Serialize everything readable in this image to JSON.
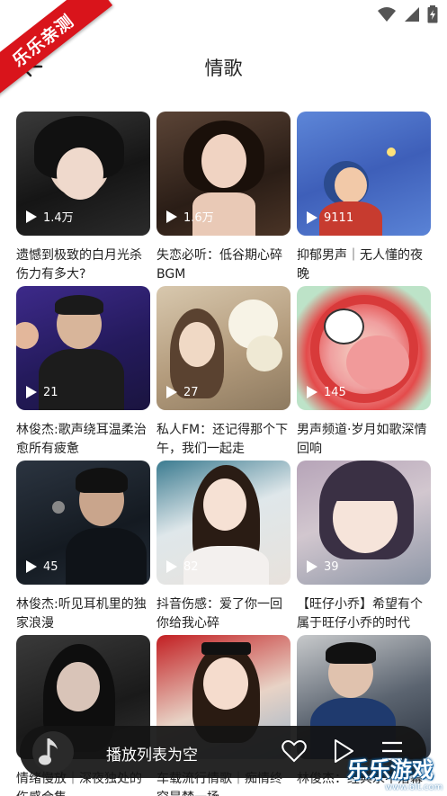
{
  "ribbon": {
    "text": "乐乐亲测"
  },
  "header": {
    "title": "情歌"
  },
  "cards": [
    {
      "count": "1.4万",
      "caption": "遗憾到极致的白月光杀伤力有多大?"
    },
    {
      "count": "1.6万",
      "caption": "失恋必听：低谷期心碎BGM"
    },
    {
      "count": "9111",
      "caption": "抑郁男声｜无人懂的夜晚"
    },
    {
      "count": "21",
      "caption": "林俊杰:歌声绕耳温柔治愈所有疲惫"
    },
    {
      "count": "27",
      "caption": "私人FM：还记得那个下午，我们一起走"
    },
    {
      "count": "145",
      "caption": "男声频道·岁月如歌深情回响"
    },
    {
      "count": "45",
      "caption": "林俊杰:听见耳机里的独家浪漫"
    },
    {
      "count": "82",
      "caption": "抖音伤感：爱了你一回你给我心碎"
    },
    {
      "count": "39",
      "caption": "【旺仔小乔】希望有个属于旺仔小乔的时代"
    },
    {
      "count": "",
      "caption": "情绪慢放｜深夜独处的伤感合集"
    },
    {
      "count": "",
      "caption": "车载流行情歌｜痴情终究是梦一场"
    },
    {
      "count": "",
      "caption": "林俊杰：经典永不落幕"
    }
  ],
  "player": {
    "title": "播放列表为空"
  },
  "watermark": {
    "text": "乐乐游戏",
    "url": "www.6lt.com"
  },
  "colors": {
    "ribbon": "#d9141b",
    "player_bg": "#141414"
  }
}
